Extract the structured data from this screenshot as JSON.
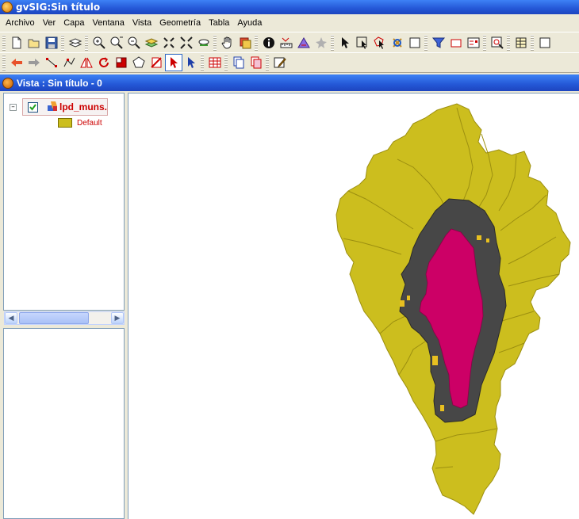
{
  "app": {
    "title": "gvSIG:Sin título"
  },
  "menu": {
    "items": [
      "Archivo",
      "Ver",
      "Capa",
      "Ventana",
      "Vista",
      "Geometría",
      "Tabla",
      "Ayuda"
    ]
  },
  "toolbar1": {
    "tools": [
      "new-doc-icon",
      "open-folder-icon",
      "save-icon",
      "layers-stack-icon",
      "zoom-in-icon",
      "zoom-select-icon",
      "zoom-out-icon",
      "full-extent-icon",
      "zoom-center-icon",
      "expand-icon",
      "zoom-previous-icon",
      "pan-hand-icon",
      "layer-properties-icon",
      "info-icon",
      "measure-distance-icon",
      "measure-area-icon",
      "star-icon",
      "select-icon",
      "select-rectangle-icon",
      "select-polygon-icon",
      "select-layer-icon",
      "deselect-icon",
      "filter-icon",
      "rectangle-icon",
      "legend-icon",
      "locate-icon",
      "table-icon",
      "raster-icon"
    ]
  },
  "toolbar2": {
    "tools": [
      "back-arrow-icon",
      "forward-arrow-icon",
      "line-icon",
      "polyline-icon",
      "symmetry-icon",
      "rotate-icon",
      "scale-icon",
      "polygon-icon",
      "delete-icon",
      "select-pointer-icon",
      "edit-vertex-icon",
      "attribute-table-icon",
      "copy-layer-icon",
      "paste-layer-icon",
      "edit-icon"
    ],
    "active": "select-pointer-icon"
  },
  "document": {
    "title": "Vista : Sin título - 0"
  },
  "toc": {
    "layer": {
      "name": "lpd_muns.s",
      "visible": true
    },
    "legend": {
      "label": "Default",
      "color": "#CCBE1E"
    }
  },
  "map": {
    "fill_color": "#CCBE1E",
    "buffer_color": "#4A4A4A",
    "highlight_color": "#CC0066"
  }
}
